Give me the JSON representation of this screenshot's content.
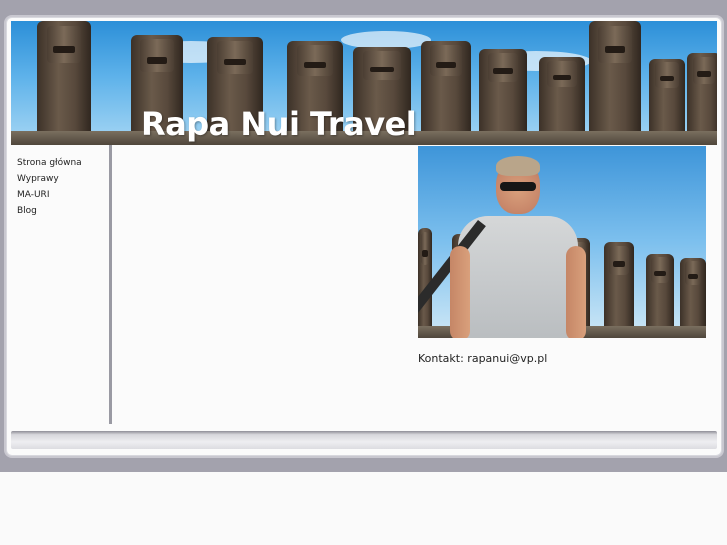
{
  "header": {
    "site_title": "Rapa Nui Travel",
    "banner_image": "moai-statues-banner"
  },
  "sidebar": {
    "items": [
      {
        "label": "Strona główna"
      },
      {
        "label": "Wyprawy"
      },
      {
        "label": "MA-URI"
      },
      {
        "label": "Blog"
      }
    ]
  },
  "main": {
    "photo": "traveler-with-moai-photo",
    "contact_text": "Kontakt: rapanui@vp.pl"
  },
  "colors": {
    "page_backdrop": "#a3a2ad",
    "frame_background": "#fbfbfb",
    "sidebar_divider": "#9a9aa3",
    "title_text": "#ffffff"
  }
}
